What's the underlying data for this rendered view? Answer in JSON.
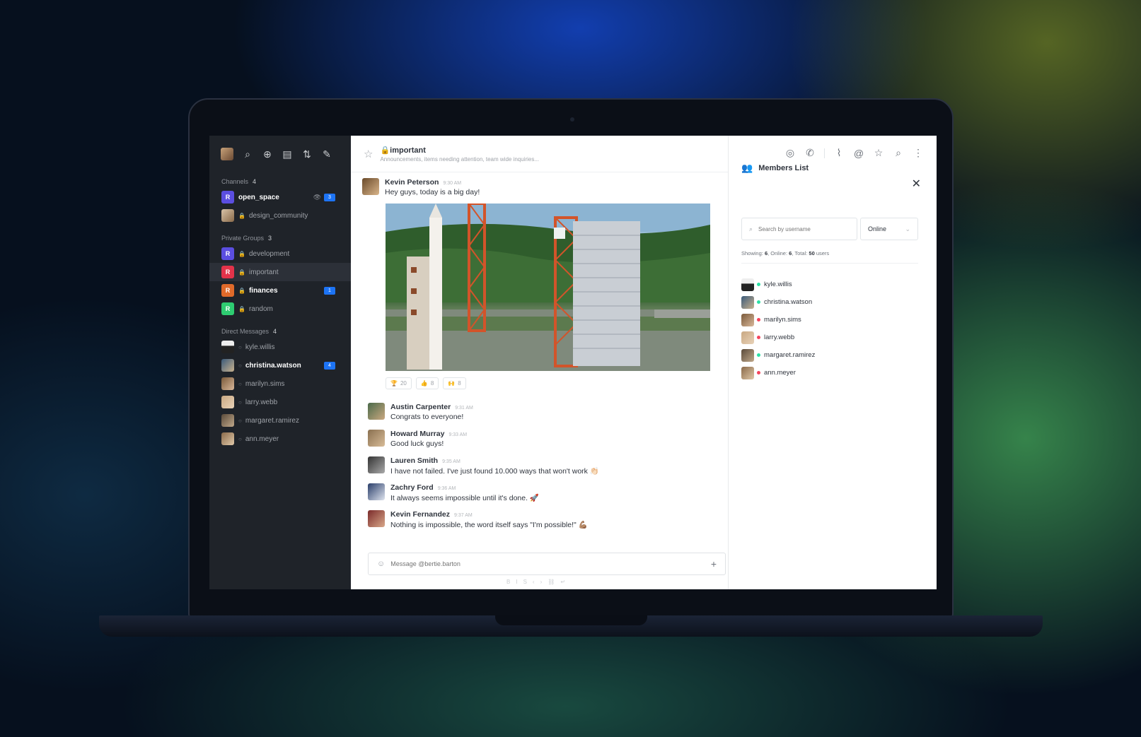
{
  "sidebar": {
    "channels_label": "Channels",
    "channels_count": "4",
    "private_label": "Private Groups",
    "private_count": "3",
    "dm_label": "Direct Messages",
    "dm_count": "4",
    "channels": [
      {
        "name": "open_space",
        "icon": "R",
        "color": "#5b4ee0",
        "badge": "3"
      },
      {
        "name": "design_community",
        "icon": "",
        "color": "#a38a6a"
      }
    ],
    "groups": [
      {
        "name": "development",
        "icon": "R",
        "color": "#5b4ee0"
      },
      {
        "name": "important",
        "icon": "R",
        "color": "#e3334a"
      },
      {
        "name": "finances",
        "icon": "R",
        "color": "#e06a2a",
        "badge": "1"
      },
      {
        "name": "random",
        "icon": "R",
        "color": "#2ecc71"
      }
    ],
    "dms": [
      {
        "name": "kyle.willis"
      },
      {
        "name": "christina.watson",
        "badge": "4"
      },
      {
        "name": "marilyn.sims"
      },
      {
        "name": "larry.webb"
      },
      {
        "name": "margaret.ramirez"
      },
      {
        "name": "ann.meyer"
      }
    ]
  },
  "room": {
    "title": "important",
    "topic": "Announcements, items needing attention, team wide inquiries..."
  },
  "messages": [
    {
      "author": "Kevin Peterson",
      "time": "9:30 AM",
      "text": "Hey guys, today is a big day!"
    },
    {
      "author": "Austin Carpenter",
      "time": "9:31 AM",
      "text": "Congrats to everyone!"
    },
    {
      "author": "Howard Murray",
      "time": "9:33 AM",
      "text": "Good luck guys!"
    },
    {
      "author": "Lauren Smith",
      "time": "9:35 AM",
      "text": "I have not failed. I've just found 10.000 ways that won't work 👏🏻"
    },
    {
      "author": "Zachry Ford",
      "time": "9:36 AM",
      "text": "It always seems impossible until it's done. 🚀"
    },
    {
      "author": "Kevin Fernandez",
      "time": "9:37 AM",
      "text": "Nothing is impossible, the word itself says \"I'm possible!\" 💪🏽"
    }
  ],
  "reactions": [
    {
      "emoji": "🏆",
      "count": "20"
    },
    {
      "emoji": "👍",
      "count": "8"
    },
    {
      "emoji": "🙌",
      "count": "8"
    }
  ],
  "composer": {
    "placeholder": "Message @bertie.barton"
  },
  "members": {
    "title": "Members List",
    "search_placeholder": "Search by username",
    "filter": "Online",
    "stats_showing_label": "Showing:",
    "stats_showing": "6",
    "stats_online_label": "Online:",
    "stats_online": "6",
    "stats_total_label": "Total:",
    "stats_total": "50",
    "stats_suffix": "users",
    "list": [
      {
        "name": "kyle.willis",
        "status": "#2de0a5"
      },
      {
        "name": "christina.watson",
        "status": "#2de0a5"
      },
      {
        "name": "marilyn.sims",
        "status": "#f5455c"
      },
      {
        "name": "larry.webb",
        "status": "#f5455c"
      },
      {
        "name": "margaret.ramirez",
        "status": "#2de0a5"
      },
      {
        "name": "ann.meyer",
        "status": "#f5455c"
      }
    ]
  }
}
